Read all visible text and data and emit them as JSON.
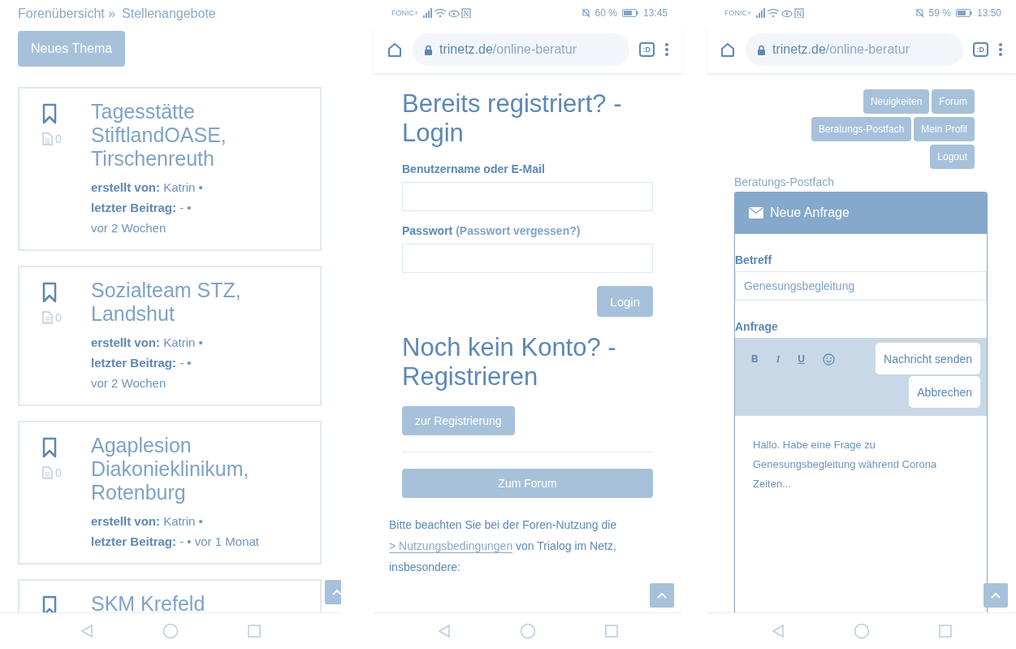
{
  "forum_screen": {
    "breadcrumb": [
      "Forenübersicht »",
      "Stellenangebote"
    ],
    "new_topic_button": "Neues Thema",
    "topics": [
      {
        "title": "Tagesstätte StiftlandOASE, Tirschenreuth",
        "count": "0",
        "meta": [
          "**erstellt von:** Katrin •",
          "**letzter Beitrag:** - •",
          "vor 2 Wochen"
        ]
      },
      {
        "title": "Sozialteam STZ, Landshut",
        "count": "0",
        "meta": [
          "**erstellt von:** Katrin •",
          "**letzter Beitrag:** - •",
          "vor 2 Wochen"
        ]
      },
      {
        "title": "Agaplesion Diakonieklinikum, Rotenburg",
        "count": "0",
        "meta": [
          "**erstellt von:** Katrin •",
          "**letzter Beitrag:** - • vor 1 Monat"
        ]
      },
      {
        "title": "SKM Krefeld"
      }
    ]
  },
  "login_screen": {
    "status_bar": {
      "carrier": "FONIC+",
      "battery": "60 %",
      "time": "13:45"
    },
    "address_bar": {
      "domain": "trinetz.de",
      "path": "/online-beratur",
      "tabs": ":D"
    },
    "login_heading": "Bereits registriert? - Login",
    "username_label": "Benutzername oder E-Mail",
    "password_label": "Passwort",
    "forgot_link": "(Passwort vergessen?)",
    "login_button": "Login",
    "register_heading": "Noch kein Konto? - Registrieren",
    "register_button": "zur Registrierung",
    "forum_button": "Zum Forum",
    "notice": {
      "before": "Bitte beachten Sie bei der Foren-Nutzung die",
      "link": "> Nutzungsbedingungen",
      "after": "von Trialog im Netz, insbesondere:"
    }
  },
  "inquiry_screen": {
    "status_bar": {
      "carrier": "FONIC+",
      "battery": "59 %",
      "time": "13:50"
    },
    "address_bar": {
      "domain": "trinetz.de",
      "path": "/online-beratur",
      "tabs": ":D"
    },
    "nav_buttons": [
      "Neuigkeiten",
      "Forum",
      "Beratungs-Postfach",
      "Mein Profil",
      "Logout"
    ],
    "breadcrumb": "Beratungs-Postfach",
    "panel_title": "Neue Anfrage",
    "subject_label": "Betreff",
    "subject_value": "Genesungsbegleitung",
    "message_label": "Anfrage",
    "format_buttons": [
      {
        "label": "B",
        "kind": "bold"
      },
      {
        "label": "I",
        "kind": "italic"
      },
      {
        "label": "U",
        "kind": "underline"
      },
      {
        "kind": "emoji"
      }
    ],
    "send_button": "Nachricht senden",
    "cancel_button": "Abbrechen",
    "message": "Hallo. Habe eine Frage zu Genesungsbegleitung während Corona Zeiten..."
  }
}
